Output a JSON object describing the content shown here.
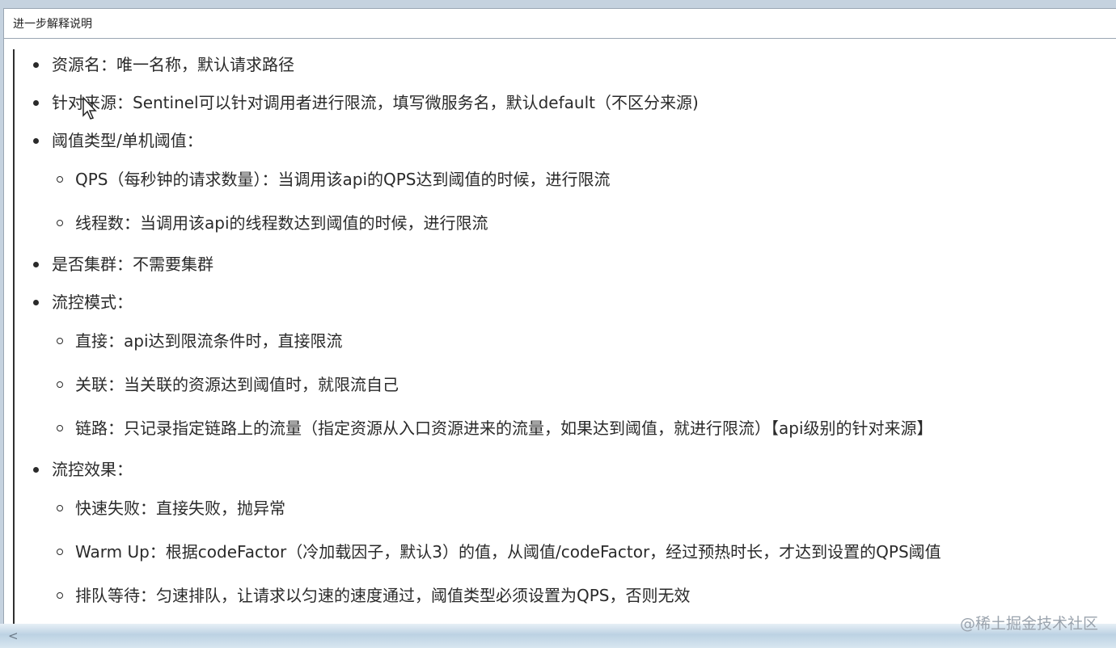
{
  "window": {
    "title": "进一步解释说明"
  },
  "items": [
    {
      "text": "资源名：唯一名称，默认请求路径"
    },
    {
      "text": "针对来源：Sentinel可以针对调用者进行限流，填写微服务名，默认default（不区分来源)"
    },
    {
      "text": "阈值类型/单机阈值：",
      "children": [
        "QPS（每秒钟的请求数量）：当调用该api的QPS达到阈值的时候，进行限流",
        "线程数：当调用该api的线程数达到阈值的时候，进行限流"
      ]
    },
    {
      "text": "是否集群：不需要集群"
    },
    {
      "text": "流控模式：",
      "children": [
        "直接：api达到限流条件时，直接限流",
        "关联：当关联的资源达到阈值时，就限流自己",
        "链路：只记录指定链路上的流量（指定资源从入口资源进来的流量，如果达到阈值，就进行限流）【api级别的针对来源】"
      ]
    },
    {
      "text": "流控效果：",
      "children": [
        "快速失败：直接失败，抛异常",
        "Warm Up：根据codeFactor（冷加载因子，默认3）的值，从阈值/codeFactor，经过预热时长，才达到设置的QPS阈值",
        "排队等待：匀速排队，让请求以匀速的速度通过，阈值类型必须设置为QPS，否则无效"
      ]
    }
  ],
  "watermark": "@稀土掘金技术社区",
  "scrollbar": {
    "left_arrow": "<"
  }
}
